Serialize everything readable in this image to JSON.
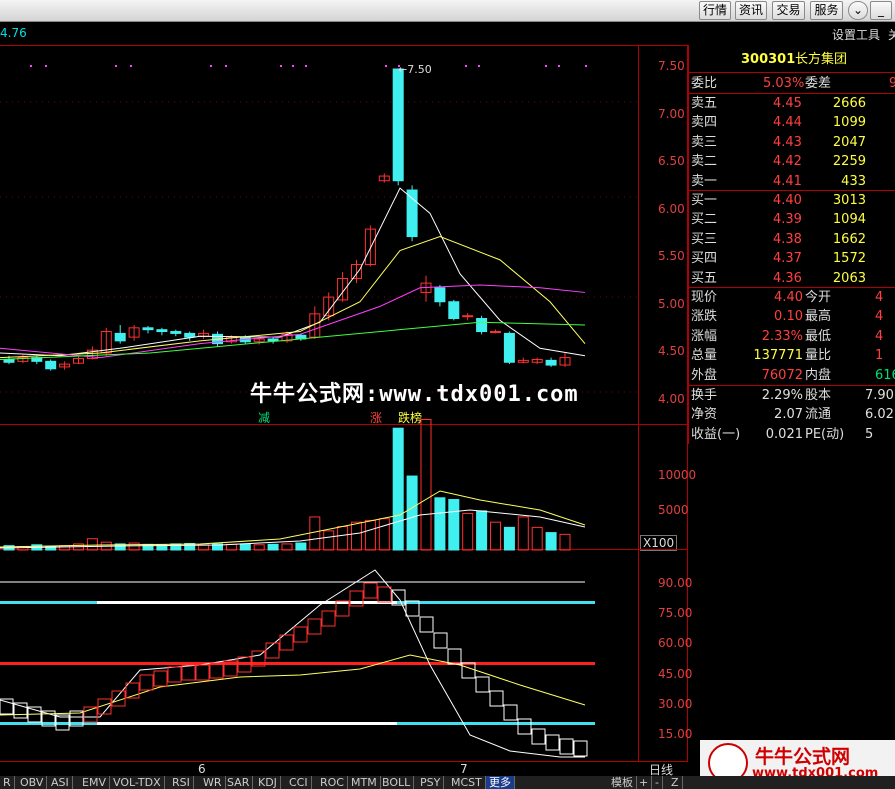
{
  "toolbar": {
    "buttons": [
      "行情",
      "资讯",
      "交易",
      "服务"
    ]
  },
  "subbar": {
    "left_value": "4.76",
    "tools": "设置工具",
    "right_cut": "关"
  },
  "price_panel": {
    "ticks": [
      "7.50",
      "7.00",
      "6.50",
      "6.00",
      "5.50",
      "5.00",
      "4.50",
      "4.00"
    ],
    "peak_label": "7.50",
    "markers": [
      {
        "text": "减",
        "color": "#00e070"
      },
      {
        "text": "涨",
        "color": "#ff4040"
      },
      {
        "text": "跌榜",
        "color": "#ffff40"
      }
    ]
  },
  "volume_panel": {
    "ticks": [
      "10000",
      "5000"
    ],
    "unit": "X100"
  },
  "indicator_panel": {
    "ticks": [
      "90.00",
      "75.00",
      "60.00",
      "45.00",
      "30.00",
      "15.00"
    ]
  },
  "watermark": "牛牛公式网:www.tdx001.com",
  "quote": {
    "code": "300301",
    "name": "长方集团",
    "weibi_label": "委比",
    "weibi": "5.03%",
    "weicha_label": "委差",
    "weicha_cut": "9",
    "sells": [
      {
        "label": "卖五",
        "price": "4.45",
        "vol": "2666"
      },
      {
        "label": "卖四",
        "price": "4.44",
        "vol": "1099"
      },
      {
        "label": "卖三",
        "price": "4.43",
        "vol": "2047"
      },
      {
        "label": "卖二",
        "price": "4.42",
        "vol": "2259"
      },
      {
        "label": "卖一",
        "price": "4.41",
        "vol": "433"
      }
    ],
    "buys": [
      {
        "label": "买一",
        "price": "4.40",
        "vol": "3013"
      },
      {
        "label": "买二",
        "price": "4.39",
        "vol": "1094"
      },
      {
        "label": "买三",
        "price": "4.38",
        "vol": "1662"
      },
      {
        "label": "买四",
        "price": "4.37",
        "vol": "1572"
      },
      {
        "label": "买五",
        "price": "4.36",
        "vol": "2063"
      }
    ],
    "stats": [
      {
        "l1": "现价",
        "v1": "4.40",
        "c1": "red",
        "l2": "今开",
        "v2": "4"
      },
      {
        "l1": "涨跌",
        "v1": "0.10",
        "c1": "red",
        "l2": "最高",
        "v2": "4"
      },
      {
        "l1": "涨幅",
        "v1": "2.33%",
        "c1": "red",
        "l2": "最低",
        "v2": "4"
      },
      {
        "l1": "总量",
        "v1": "137771",
        "c1": "yel",
        "l2": "量比",
        "v2": "1"
      },
      {
        "l1": "外盘",
        "v1": "76072",
        "c1": "red",
        "l2": "内盘",
        "v2": "616"
      }
    ],
    "stats2": [
      {
        "l1": "换手",
        "v1": "2.29%",
        "l2": "股本",
        "v2": "7.90"
      },
      {
        "l1": "净资",
        "v1": "2.07",
        "l2": "流通",
        "v2": "6.02"
      },
      {
        "l1": "收益(一)",
        "v1": "0.021",
        "l2": "PE(动)",
        "v2": "5"
      }
    ]
  },
  "x_labels": [
    "6",
    "7"
  ],
  "day_line": "日线",
  "bottom_tabs": [
    "R",
    "OBV",
    "ASI",
    "EMV",
    "VOL-TDX",
    "RSI",
    "WR",
    "SAR",
    "KDJ",
    "CCI",
    "ROC",
    "MTM",
    "BOLL",
    "PSY",
    "MCST",
    "更多"
  ],
  "bottom_right": [
    "模板",
    "+",
    "-",
    "Z"
  ],
  "logo": {
    "text": "牛牛公式网",
    "url": "www.tdx001.com"
  },
  "colors": {
    "up": "#ff3030",
    "down": "#40f0f0",
    "axis": "#b00000"
  }
}
